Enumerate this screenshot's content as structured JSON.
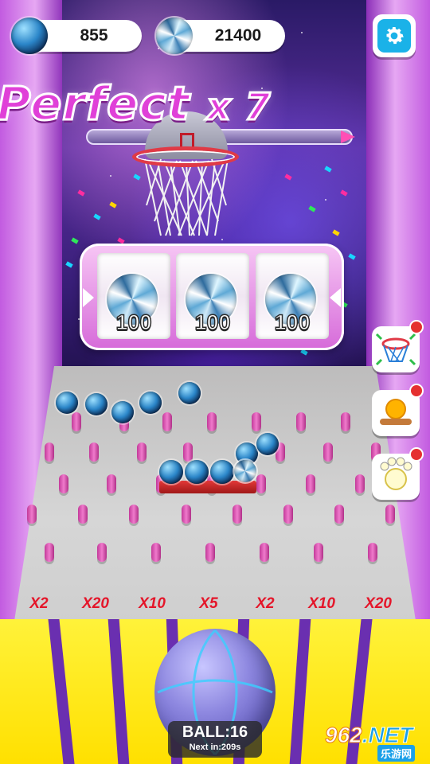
{
  "hud": {
    "balls_count": "855",
    "gems_count": "21400",
    "settings_icon": "gear-icon"
  },
  "banner": {
    "text": "Perfect",
    "combo": "x 7"
  },
  "slots": [
    {
      "icon": "diamond-ball-icon",
      "value": "100"
    },
    {
      "icon": "diamond-ball-icon",
      "value": "100"
    },
    {
      "icon": "diamond-ball-icon",
      "value": "100"
    }
  ],
  "multipliers": [
    "X2",
    "X20",
    "X10",
    "X5",
    "X2",
    "X10",
    "X20"
  ],
  "ball_counter": {
    "label": "BALL:16",
    "next": "Next in:209s"
  },
  "side_buttons": [
    {
      "icon": "hoop-net-icon"
    },
    {
      "icon": "coin-stack-icon"
    },
    {
      "icon": "paw-orb-icon"
    }
  ],
  "watermark": {
    "brand": "962",
    "tld": ".NET",
    "sub": "乐游网"
  },
  "colors": {
    "multiplier": "#e4162a",
    "lane": "#ffe000",
    "divider": "#6a2fb0",
    "peg": "#f07acc",
    "settings": "#1ab2e8"
  }
}
